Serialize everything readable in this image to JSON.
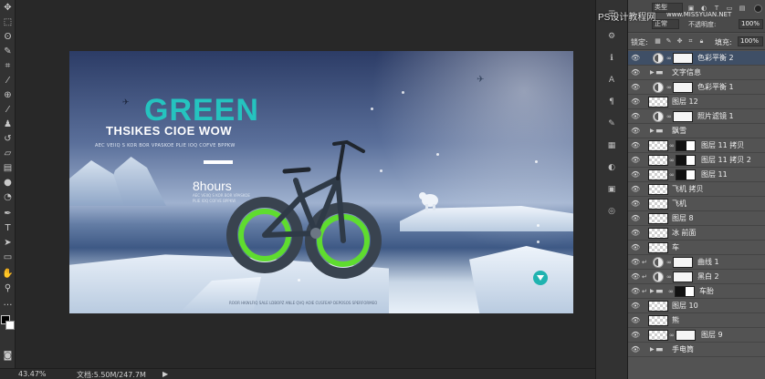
{
  "watermark": {
    "title": "PS设计教程网",
    "url": "www.MISSYUAN.NET"
  },
  "layers_panel": {
    "kind_filter": "类型",
    "blend_mode": "正常",
    "opacity_label": "不透明度:",
    "opacity_value": "100%",
    "lock_label": "锁定:",
    "fill_label": "填充:",
    "fill_value": "100%",
    "layers": [
      {
        "name": "色彩平衡 2",
        "type": "adjustment",
        "visible": true,
        "selected": true
      },
      {
        "name": "文字信息",
        "type": "group",
        "visible": true
      },
      {
        "name": "色彩平衡 1",
        "type": "adjustment",
        "visible": true
      },
      {
        "name": "图层 12",
        "type": "pixel",
        "visible": true
      },
      {
        "name": "照片滤镜 1",
        "type": "adjustment",
        "visible": true
      },
      {
        "name": "飘雪",
        "type": "group",
        "visible": true
      },
      {
        "name": "图层 11 拷贝",
        "type": "pixel-mask",
        "visible": true
      },
      {
        "name": "图层 11 拷贝 2",
        "type": "pixel-mask",
        "visible": true
      },
      {
        "name": "图层 11",
        "type": "pixel-mask",
        "visible": true
      },
      {
        "name": "飞机 拷贝",
        "type": "pixel",
        "visible": true
      },
      {
        "name": "飞机",
        "type": "pixel",
        "visible": true
      },
      {
        "name": "图层 8",
        "type": "pixel",
        "visible": true
      },
      {
        "name": "冰 前面",
        "type": "pixel",
        "visible": true
      },
      {
        "name": "车",
        "type": "pixel",
        "visible": true
      },
      {
        "name": "曲线 1",
        "type": "adjustment-clip",
        "visible": true
      },
      {
        "name": "黑白 2",
        "type": "adjustment-clip-bw",
        "visible": true
      },
      {
        "name": "车胎",
        "type": "group-clip",
        "visible": true
      },
      {
        "name": "图层 10",
        "type": "pixel",
        "visible": true
      },
      {
        "name": "熊",
        "type": "pixel",
        "visible": true
      },
      {
        "name": "图层 9",
        "type": "pixel-mask",
        "visible": true
      },
      {
        "name": "手电筒",
        "type": "group",
        "visible": true
      }
    ]
  },
  "artboard": {
    "headline": "GREEN",
    "subheadline": "THSIKES CIOE WOW",
    "tagline": "AEC VEIIQ S KOR BOR VPASKOE PLIE IOQ COFVE BPPKW",
    "hours": "8hours",
    "hours_note_1": "AEC VEIIQ S KOR BOR VPASKOE",
    "hours_note_2": "PLIE IOQ COFVE BPPKW",
    "footer": "ROOR HKWLFIQ SALE LDBOPZ ANLE QVQ AOIE CUSFEAP DEPOSOS SPERFORMEO",
    "accent_color": "#25c3bf"
  },
  "status": {
    "zoom": "43.47%",
    "doc_size": "文档:5.50M/247.7M"
  }
}
